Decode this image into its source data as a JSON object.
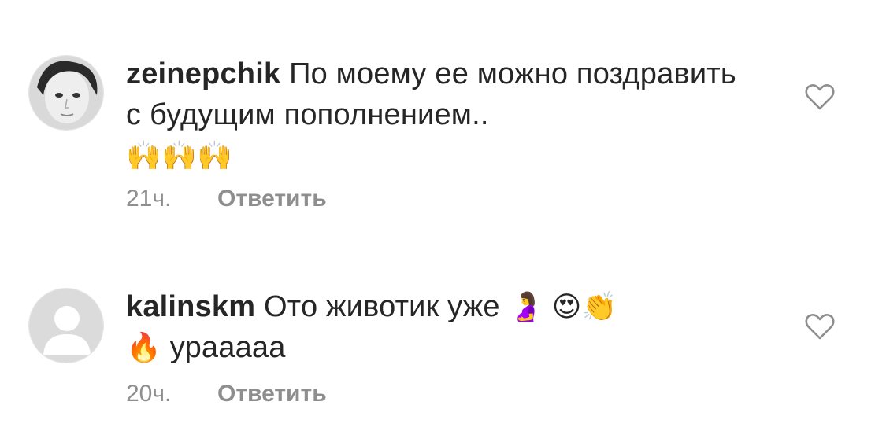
{
  "comments": [
    {
      "username": "zeinepchik",
      "text": "По моему ее можно поздравить с будущим пополнением..",
      "emoji": "🙌🙌🙌",
      "time": "21ч.",
      "reply_label": "Ответить",
      "avatar": "user-photo-avatar",
      "like_icon": "heart-outline-icon"
    },
    {
      "username": "kalinskm",
      "text_before": "Ото животик уже",
      "emoji_inline": "🤰 😍👏",
      "emoji_lead": "🔥",
      "text_after": "урааааа",
      "time": "20ч.",
      "reply_label": "Ответить",
      "avatar": "default-avatar",
      "like_icon": "heart-outline-icon"
    }
  ],
  "colors": {
    "text": "#262626",
    "secondary": "#8e8e8e",
    "background": "#ffffff"
  }
}
